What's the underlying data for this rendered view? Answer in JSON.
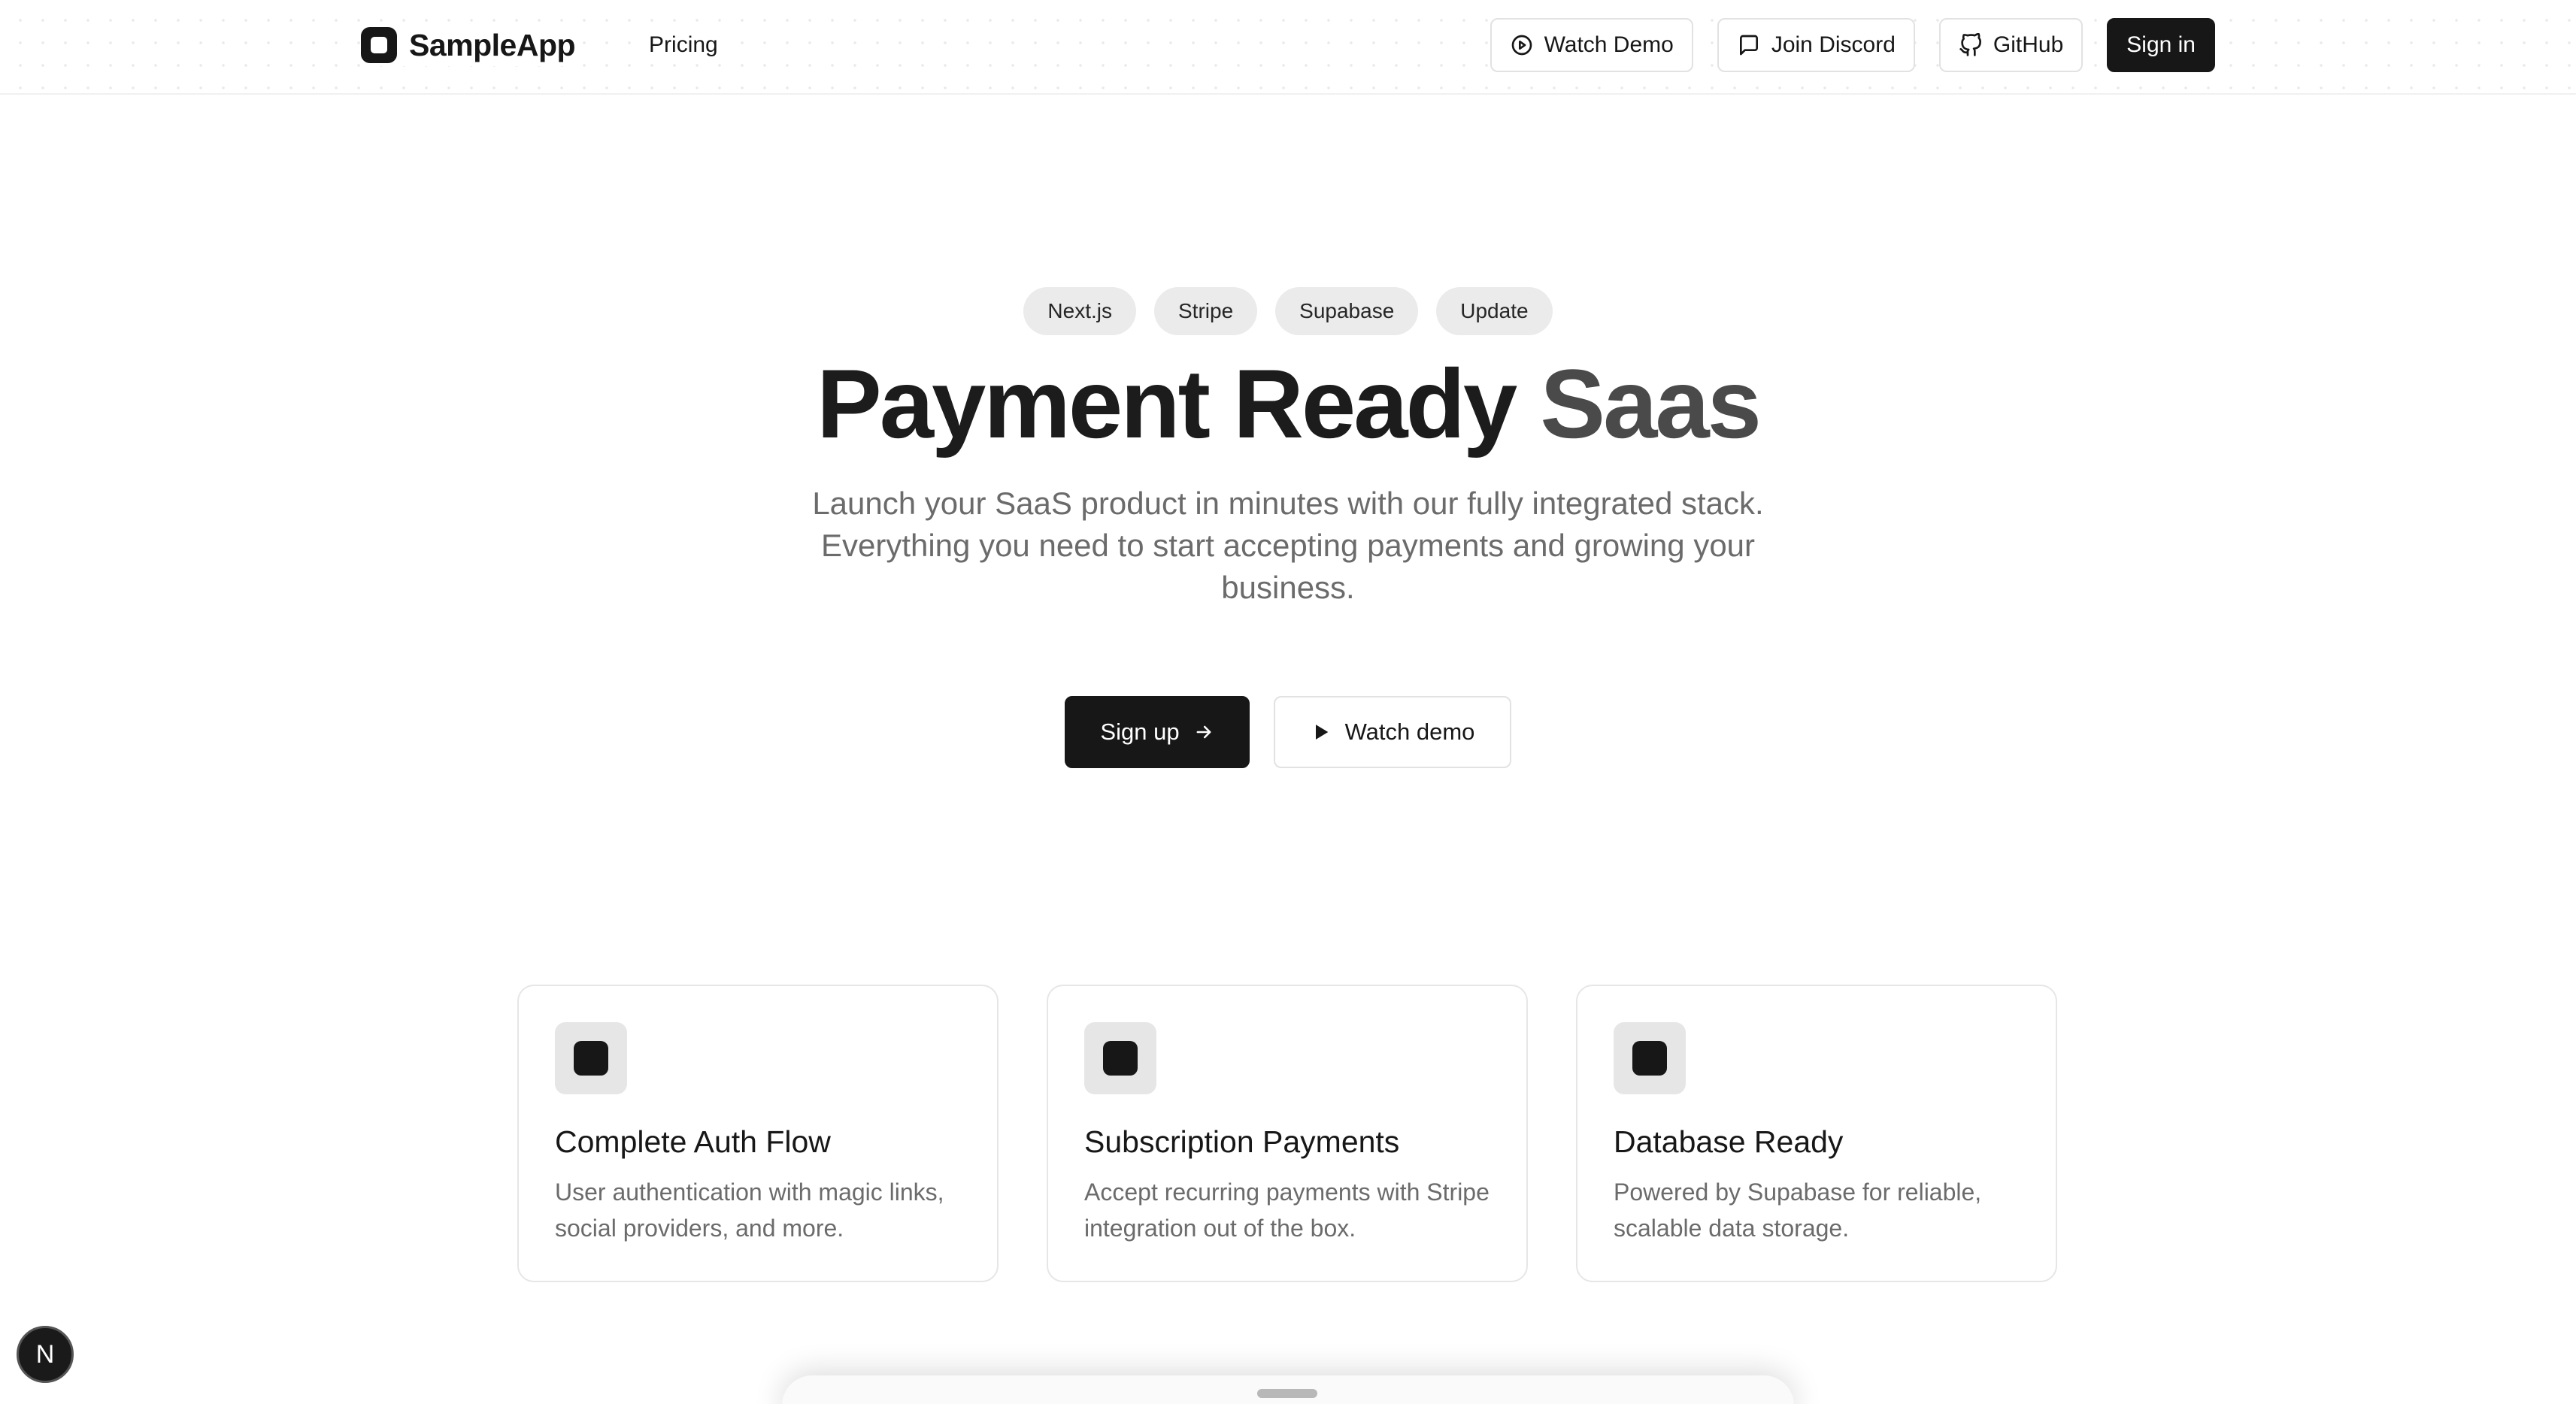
{
  "header": {
    "brand": "SampleApp",
    "nav": {
      "pricing": "Pricing"
    },
    "buttons": {
      "watch_demo": "Watch Demo",
      "join_discord": "Join Discord",
      "github": "GitHub",
      "sign_in": "Sign in"
    }
  },
  "hero": {
    "badges": [
      "Next.js",
      "Stripe",
      "Supabase",
      "Update"
    ],
    "title_part1": "Payment Ready",
    "title_part2": "Saas",
    "subtitle": "Launch your SaaS product in minutes with our fully integrated stack. Everything you need to start accepting payments and growing your business.",
    "cta_primary": "Sign up",
    "cta_secondary": "Watch demo"
  },
  "features": [
    {
      "title": "Complete Auth Flow",
      "description": "User authentication with magic links, social providers, and more."
    },
    {
      "title": "Subscription Payments",
      "description": "Accept recurring payments with Stripe integration out of the box."
    },
    {
      "title": "Database Ready",
      "description": "Powered by Supabase for reliable, scalable data storage."
    }
  ],
  "dev_badge": {
    "letter": "N"
  },
  "colors": {
    "primary": "#171717",
    "muted_text": "#6b6b6b",
    "badge_bg": "#ebebeb",
    "border": "#e2e2e2"
  },
  "icons": {
    "brand": "app-logo-icon",
    "watch_demo": "play-circle-icon",
    "join_discord": "message-square-icon",
    "github": "github-icon",
    "sign_up": "arrow-right-icon",
    "watch_demo_cta": "play-icon",
    "feature": "square-icon"
  }
}
